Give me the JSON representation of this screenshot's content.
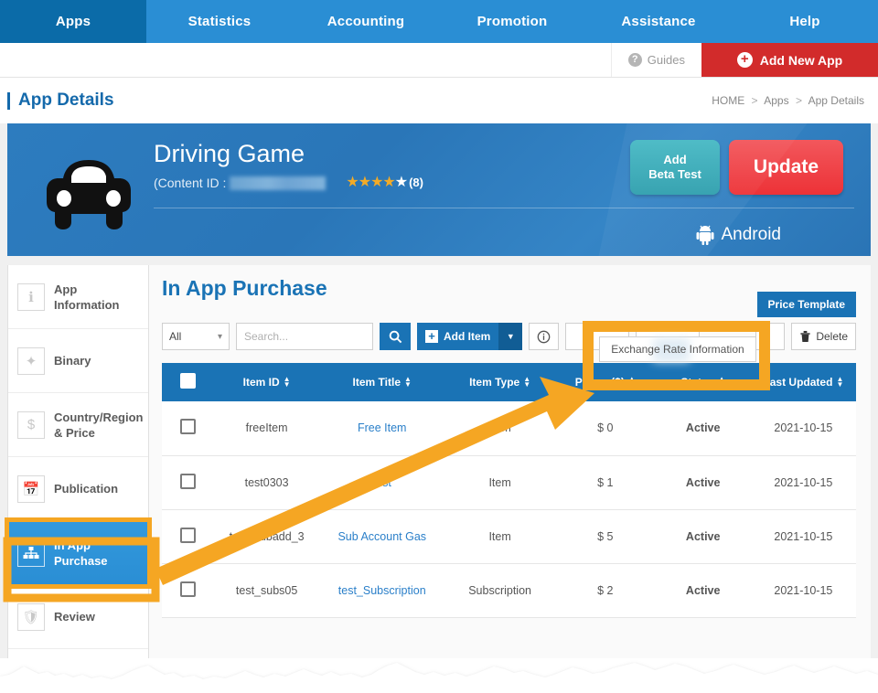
{
  "topnav": {
    "items": [
      {
        "label": "Apps",
        "active": true
      },
      {
        "label": "Statistics",
        "active": false
      },
      {
        "label": "Accounting",
        "active": false
      },
      {
        "label": "Promotion",
        "active": false
      },
      {
        "label": "Assistance",
        "active": false
      },
      {
        "label": "Help",
        "active": false
      }
    ]
  },
  "subbar": {
    "guides_label": "Guides",
    "guides_icon": "question-circle-icon",
    "add_new_app_label": "Add New App",
    "add_new_app_icon": "plus-circle-icon"
  },
  "header": {
    "page_title": "App Details",
    "breadcrumb": [
      "HOME",
      "Apps",
      "App Details"
    ],
    "breadcrumb_separator": ">"
  },
  "banner": {
    "app_icon": "car-icon",
    "app_name": "Driving Game",
    "content_id_label": "(Content ID :",
    "content_id_value": "",
    "rating": {
      "filled": 4,
      "total": 5,
      "count_label": "(8)"
    },
    "platform_label": "Android",
    "platform_icon": "android-icon",
    "beta_button_line1": "Add",
    "beta_button_line2": "Beta Test",
    "update_button": "Update",
    "accent_blue": "#2a76b8",
    "beta_color": "#2f9fae",
    "update_color": "#ed3237"
  },
  "sidebar": {
    "items": [
      {
        "label": "App Information",
        "icon": "info-doc-icon",
        "active": false
      },
      {
        "label": "Binary",
        "icon": "binary-icon",
        "active": false
      },
      {
        "label": "Country/Region & Price",
        "icon": "dollar-icon",
        "active": false
      },
      {
        "label": "Publication",
        "icon": "calendar-icon",
        "active": false
      },
      {
        "label": "In App Purchase",
        "icon": "sitemap-icon",
        "active": true
      },
      {
        "label": "Review",
        "icon": "shield-icon",
        "active": false
      }
    ]
  },
  "content": {
    "title": "In App Purchase",
    "toolbar": {
      "filter_selected": "All",
      "search_placeholder": "Search...",
      "search_value": "",
      "search_icon": "magnifier-icon",
      "add_item_label": "Add Item",
      "add_item_icon": "plus-square-icon",
      "add_item_caret": "chevron-down-icon",
      "info_icon": "info-circle-icon",
      "price_template_label": "Price Template",
      "delete_label": "Delete",
      "delete_icon": "trash-icon"
    },
    "table": {
      "columns": [
        {
          "label": "",
          "name": "select"
        },
        {
          "label": "Item ID",
          "name": "item-id"
        },
        {
          "label": "Item Title",
          "name": "item-title"
        },
        {
          "label": "Item Type",
          "name": "item-type"
        },
        {
          "label": "Prices ($)",
          "name": "prices"
        },
        {
          "label": "Status",
          "name": "status"
        },
        {
          "label": "Last Updated",
          "name": "last-updated"
        }
      ],
      "rows": [
        {
          "item_id": "freeItem",
          "item_title": "Free Item",
          "item_type": "Item",
          "price": "$ 0",
          "status": "Active",
          "updated": "2021-10-15"
        },
        {
          "item_id": "test0303",
          "item_title": "test",
          "item_type": "Item",
          "price": "$ 1",
          "status": "Active",
          "updated": "2021-10-15"
        },
        {
          "item_id": "test_subadd_3",
          "item_title": "Sub Account Gas",
          "item_type": "Item",
          "price": "$ 5",
          "status": "Active",
          "updated": "2021-10-15"
        },
        {
          "item_id": "test_subs05",
          "item_title": "test_Subscription",
          "item_type": "Subscription",
          "price": "$ 2",
          "status": "Active",
          "updated": "2021-10-15"
        }
      ]
    }
  },
  "annotation": {
    "tooltip_text": "Exchange Rate Information",
    "highlight_color": "#f5a623"
  }
}
